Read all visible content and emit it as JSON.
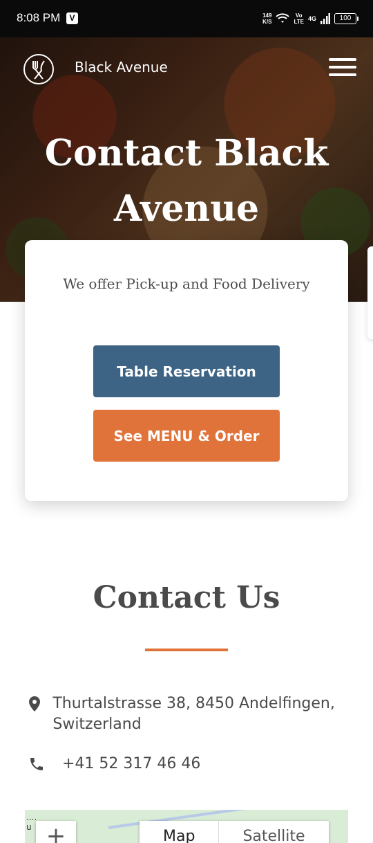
{
  "status_bar": {
    "time": "8:08 PM",
    "app_badge": "V",
    "speed_top": "149",
    "speed_bottom": "K/S",
    "volte_top": "Vo",
    "volte_bottom": "LTE",
    "network": "4G",
    "battery": "100"
  },
  "header": {
    "brand": "Black Avenue",
    "logo_icon": "fork-knife-icon",
    "menu_icon": "hamburger-menu-icon"
  },
  "hero": {
    "title": "Contact Black Avenue"
  },
  "card": {
    "tagline": "We offer Pick-up and Food Delivery",
    "reserve_label": "Table Reservation",
    "order_label": "See MENU & Order"
  },
  "contact": {
    "title": "Contact Us",
    "address": "Thurtalstrasse 38, 8450 Andelfingen, Switzerland",
    "phone": "+41 52 317 46 46"
  },
  "map": {
    "zoom_in": "+",
    "map_label": "Map",
    "satellite_label": "Satellite"
  },
  "colors": {
    "primary_blue": "#3d6484",
    "accent_orange": "#e0733a",
    "text_gray": "#4a4a4a"
  }
}
